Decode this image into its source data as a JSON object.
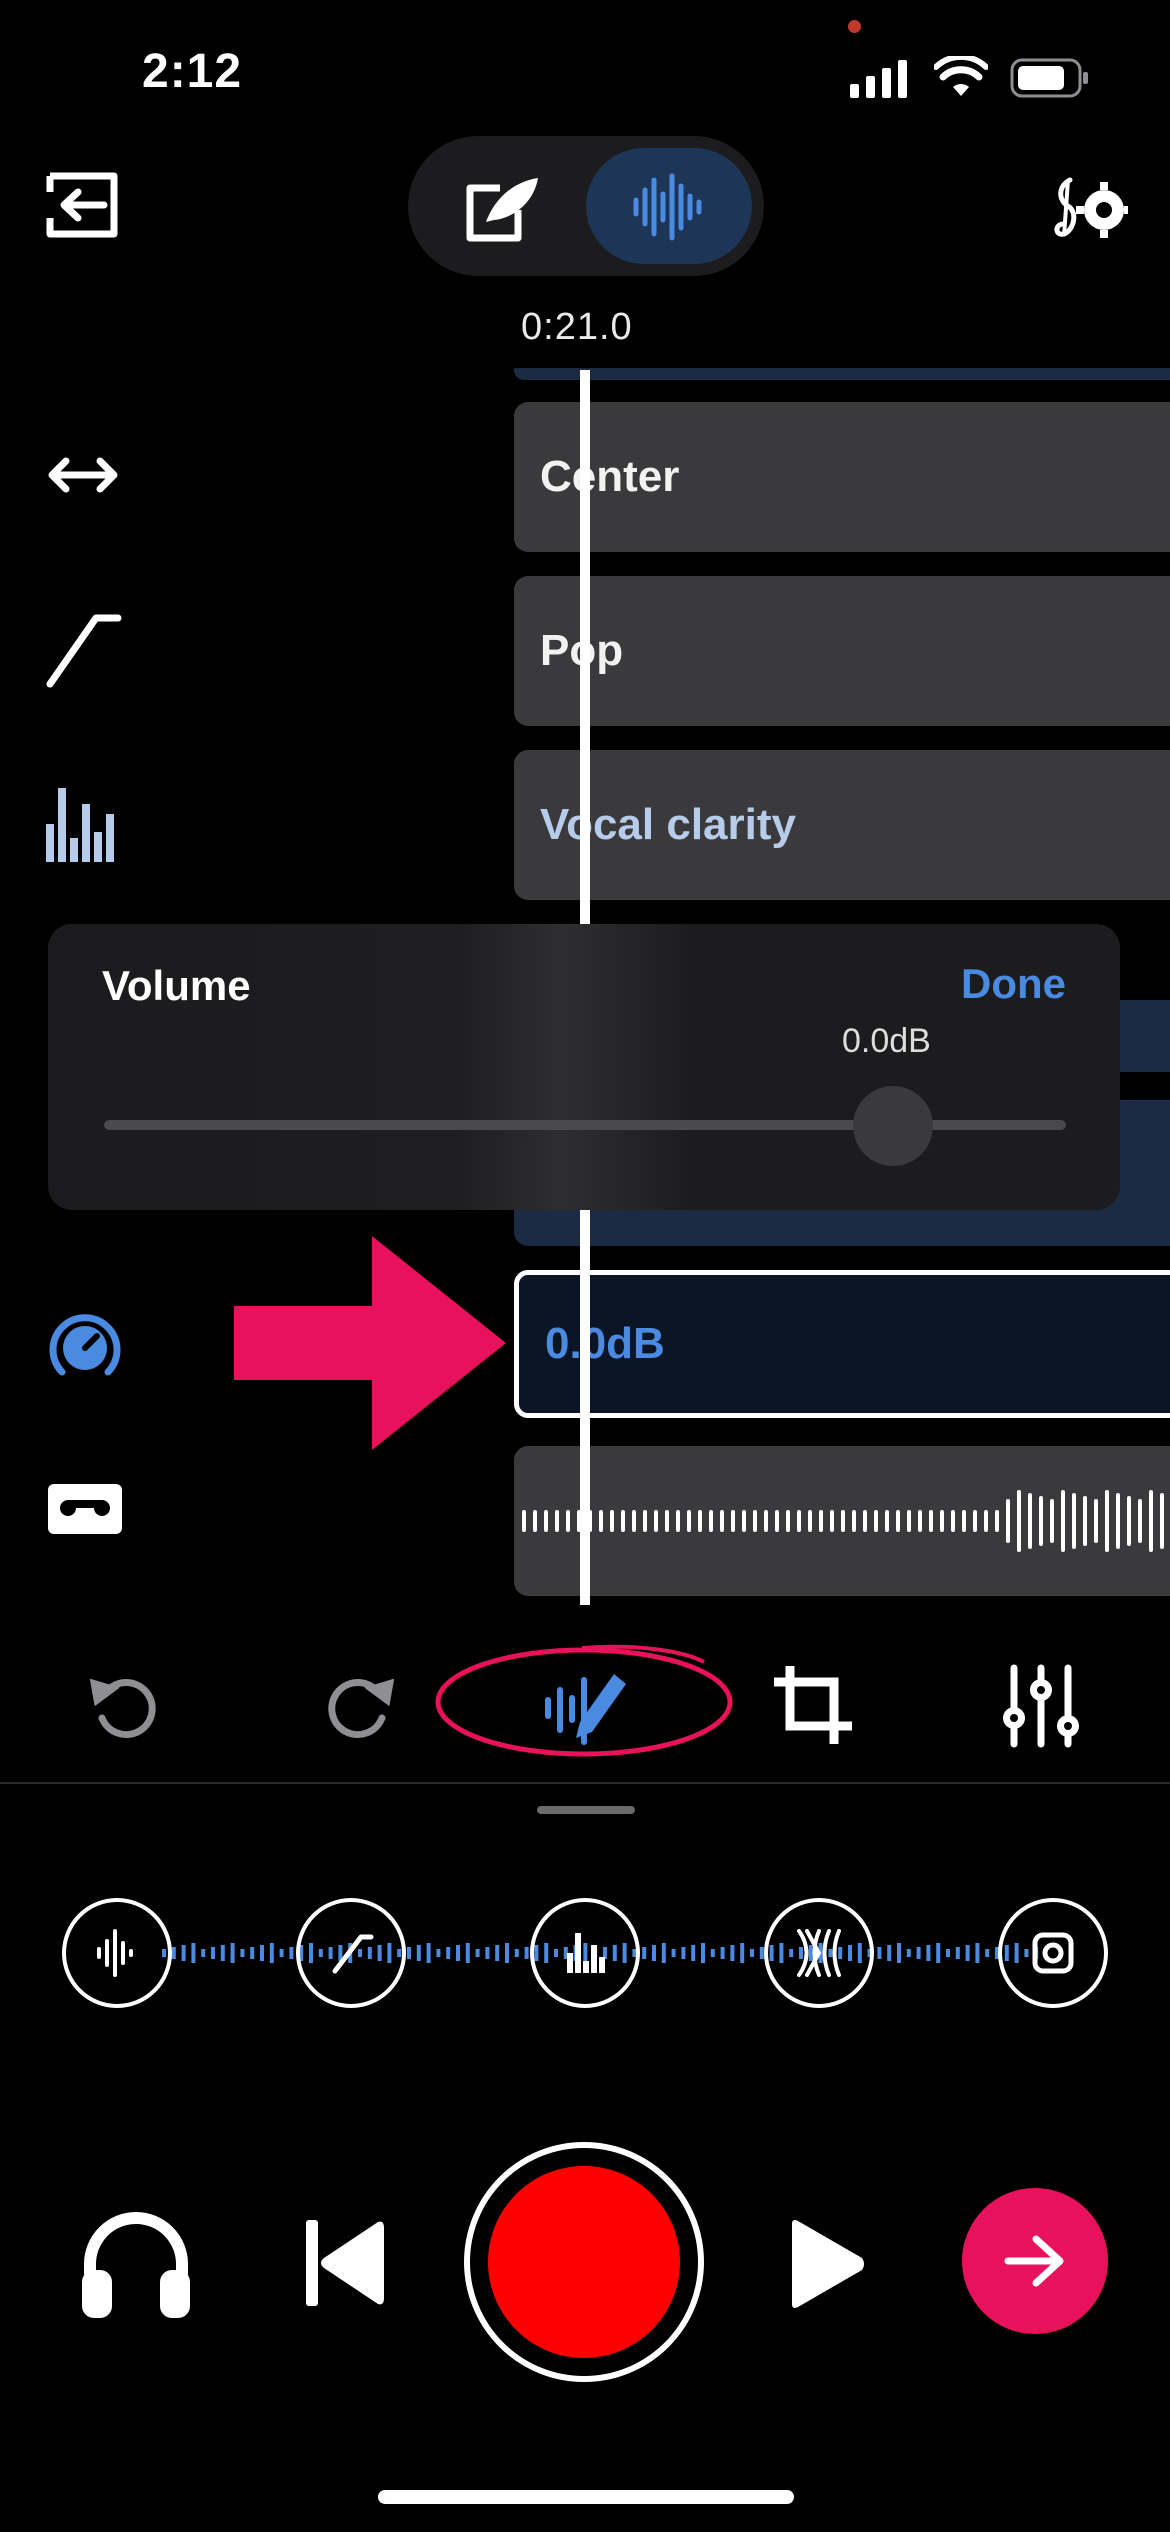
{
  "status_bar": {
    "time": "2:12"
  },
  "timeline": {
    "timecode": "0:21.0"
  },
  "tracks": [
    {
      "label": "Center"
    },
    {
      "label": "Pop"
    },
    {
      "label": "Vocal clarity"
    },
    {
      "label": "0.0dB"
    }
  ],
  "volume_popup": {
    "title": "Volume",
    "done_label": "Done",
    "value_label": "0.0dB",
    "slider_level": 0.82
  },
  "colors": {
    "accent_blue": "#4a8ae0",
    "record_red": "#ff0000",
    "next_pink": "#e8125c",
    "annotation_pink": "#e8125c"
  },
  "icons": {
    "top_left": "exit-icon",
    "mode_edit": "compose-icon",
    "mode_waveform": "waveform-icon",
    "settings": "music-settings-icon",
    "left_column": [
      "stereo-width-icon",
      "compressor-curve-icon",
      "equalizer-icon",
      "volume-knob-icon",
      "tape-icon"
    ],
    "toolbar": [
      "undo-icon",
      "redo-icon",
      "edit-waveform-icon",
      "crop-icon",
      "mixer-sliders-icon"
    ],
    "fx_chain": [
      "noise-gate-icon",
      "compressor-icon",
      "eq-icon",
      "reverb-icon",
      "limiter-icon"
    ],
    "transport": [
      "headphones-icon",
      "skip-back-icon",
      "record-icon",
      "play-icon",
      "next-arrow-icon"
    ]
  }
}
